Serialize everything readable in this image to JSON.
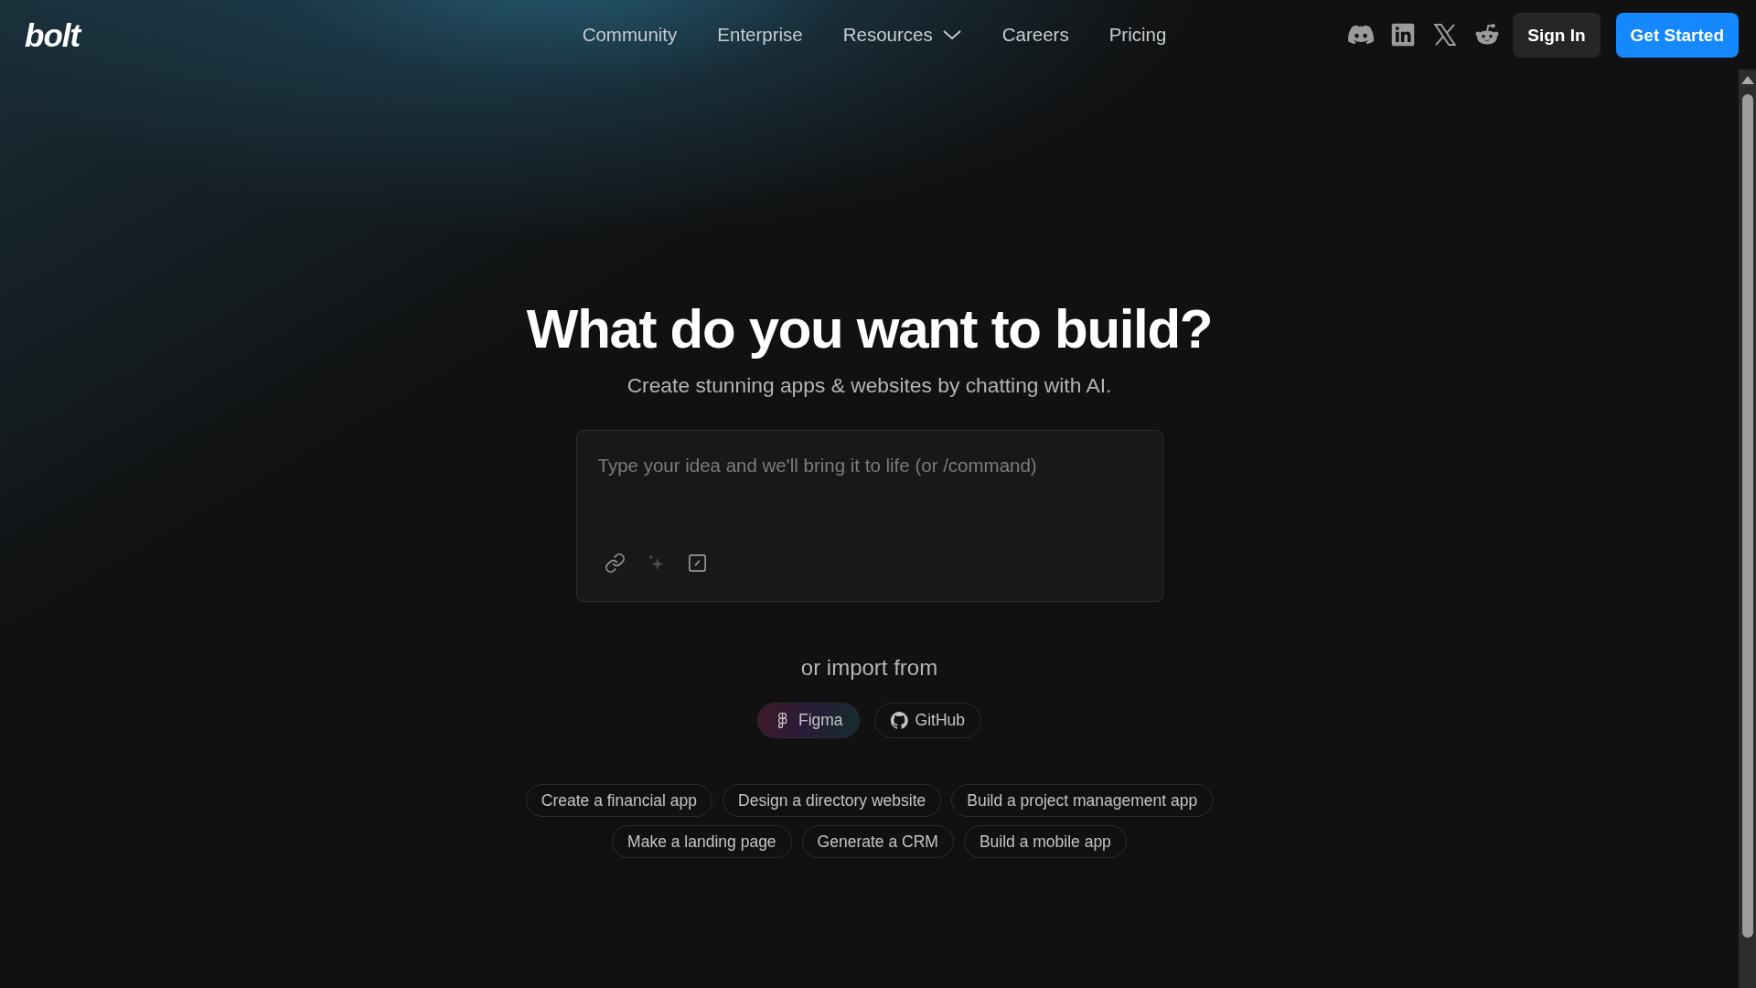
{
  "header": {
    "logo": "bolt",
    "nav": [
      {
        "label": "Community",
        "kind": "link"
      },
      {
        "label": "Enterprise",
        "kind": "link"
      },
      {
        "label": "Resources",
        "kind": "dropdown"
      },
      {
        "label": "Careers",
        "kind": "link"
      },
      {
        "label": "Pricing",
        "kind": "link"
      }
    ],
    "buttons": [
      {
        "label": "Sign In",
        "kind": "secondary"
      },
      {
        "label": "Get Started",
        "kind": "primary"
      }
    ]
  },
  "hero": {
    "title": "What do you want to build?",
    "subtitle": "Create stunning apps & websites by chatting with AI."
  },
  "prompt": {
    "placeholder": "Type your idea and we'll bring it to life (or /command)"
  },
  "import": {
    "label": "or import from",
    "sources": [
      {
        "label": "Figma",
        "highlighted": true
      },
      {
        "label": "GitHub",
        "highlighted": false
      }
    ]
  },
  "suggestion_rows": [
    {
      "items": [
        "Create a financial app",
        "Design a directory website",
        "Build a project management app"
      ]
    },
    {
      "items": [
        "Make a landing page",
        "Generate a CRM",
        "Build a mobile app"
      ]
    }
  ]
}
